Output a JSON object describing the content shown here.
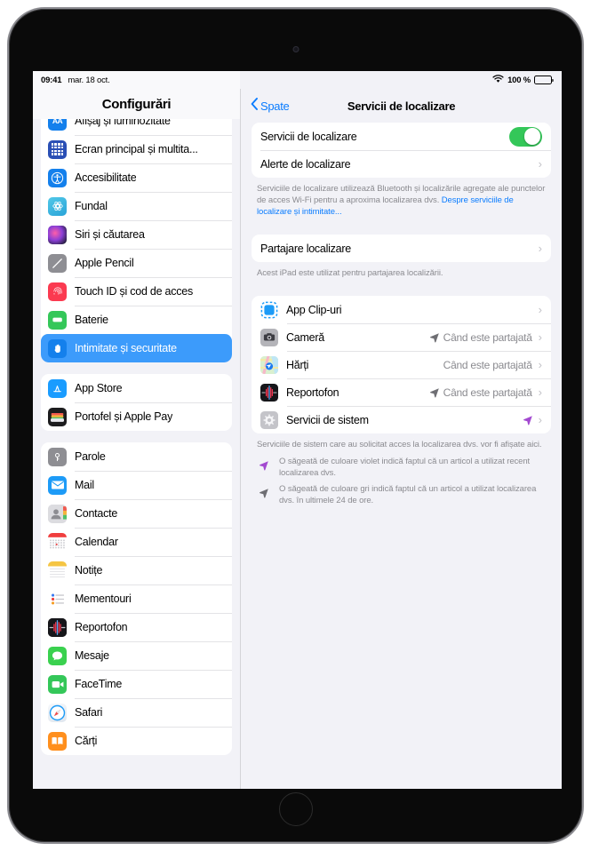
{
  "status_bar": {
    "time": "09:41",
    "date": "mar. 18 oct.",
    "wifi_icon": "wifi-icon",
    "battery_percent": "100 %",
    "battery_icon": "battery-full-icon"
  },
  "sidebar": {
    "title": "Configurări",
    "groups": [
      {
        "items": [
          {
            "label": "Afișaj și luminozitate",
            "icon": "display-icon",
            "selected": false
          },
          {
            "label": "Ecran principal și multita...",
            "icon": "home-screen-icon",
            "selected": false
          },
          {
            "label": "Accesibilitate",
            "icon": "accessibility-icon",
            "selected": false
          },
          {
            "label": "Fundal",
            "icon": "wallpaper-icon",
            "selected": false
          },
          {
            "label": "Siri și căutarea",
            "icon": "siri-icon",
            "selected": false
          },
          {
            "label": "Apple Pencil",
            "icon": "apple-pencil-icon",
            "selected": false
          },
          {
            "label": "Touch ID și cod de acces",
            "icon": "touch-id-icon",
            "selected": false
          },
          {
            "label": "Baterie",
            "icon": "battery-icon",
            "selected": false
          },
          {
            "label": "Intimitate și securitate",
            "icon": "privacy-hand-icon",
            "selected": true
          }
        ]
      },
      {
        "items": [
          {
            "label": "App Store",
            "icon": "app-store-icon",
            "selected": false
          },
          {
            "label": "Portofel și Apple Pay",
            "icon": "wallet-icon",
            "selected": false
          }
        ]
      },
      {
        "items": [
          {
            "label": "Parole",
            "icon": "passwords-key-icon",
            "selected": false
          },
          {
            "label": "Mail",
            "icon": "mail-icon",
            "selected": false
          },
          {
            "label": "Contacte",
            "icon": "contacts-icon",
            "selected": false
          },
          {
            "label": "Calendar",
            "icon": "calendar-icon",
            "selected": false
          },
          {
            "label": "Notițe",
            "icon": "notes-icon",
            "selected": false
          },
          {
            "label": "Mementouri",
            "icon": "reminders-icon",
            "selected": false
          },
          {
            "label": "Reportofon",
            "icon": "voice-memos-icon",
            "selected": false
          },
          {
            "label": "Mesaje",
            "icon": "messages-icon",
            "selected": false
          },
          {
            "label": "FaceTime",
            "icon": "facetime-icon",
            "selected": false
          },
          {
            "label": "Safari",
            "icon": "safari-icon",
            "selected": false
          },
          {
            "label": "Cărți",
            "icon": "books-icon",
            "selected": false
          }
        ]
      }
    ]
  },
  "detail": {
    "back_label": "Spate",
    "back_icon": "chevron-left-icon",
    "title": "Servicii de localizare",
    "toggle_row": {
      "label": "Servicii de localizare",
      "toggle_on": true
    },
    "alerts_row": {
      "label": "Alerte de localizare",
      "chevron": "chevron-right-icon"
    },
    "footnote_1": {
      "text": "Serviciile de localizare utilizează Bluetooth și localizările agregate ale punctelor de acces Wi-Fi pentru a aproxima localizarea dvs. ",
      "link": "Despre serviciile de localizare și intimitate..."
    },
    "sharing_row": {
      "label": "Partajare localizare",
      "chevron": "chevron-right-icon"
    },
    "footnote_2": "Acest iPad este utilizat pentru partajarea localizării.",
    "apps": [
      {
        "label": "App Clip-uri",
        "value": "",
        "arrow": "none",
        "icon": "app-clips-icon"
      },
      {
        "label": "Cameră",
        "value": "Când este partajată",
        "arrow": "gray",
        "icon": "camera-icon"
      },
      {
        "label": "Hărți",
        "value": "Când este partajată",
        "arrow": "none",
        "icon": "maps-icon"
      },
      {
        "label": "Reportofon",
        "value": "Când este partajată",
        "arrow": "gray",
        "icon": "voice-memos-icon"
      },
      {
        "label": "Servicii de sistem",
        "value": "",
        "arrow": "purple",
        "icon": "system-services-gear-icon"
      }
    ],
    "footnote_3": "Serviciile de sistem care au solicitat acces la localizarea dvs. vor fi afișate aici.",
    "legend": [
      {
        "arrow_color": "purple",
        "text": "O săgeată de culoare violet indică faptul că un articol a utilizat recent localizarea dvs."
      },
      {
        "arrow_color": "gray",
        "text": "O săgeată de culoare gri indică faptul că un articol a utilizat localizarea dvs. în ultimele 24 de ore."
      }
    ]
  },
  "colors": {
    "accent_blue": "#0a7cff",
    "selected_row_blue": "#3c9bfb",
    "toggle_green": "#34c759",
    "arrow_purple": "#a34ad0",
    "arrow_gray": "#6e6e73",
    "background": "#f2f2f7"
  }
}
